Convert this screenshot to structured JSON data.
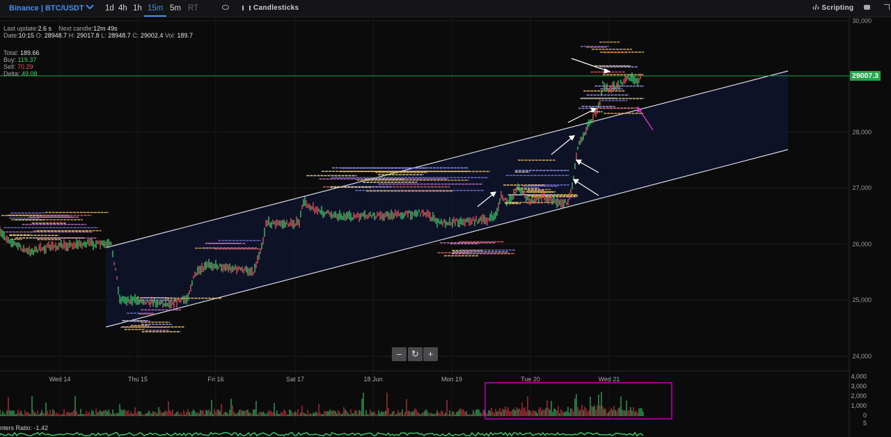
{
  "toolbar": {
    "symbol": "Binance | BTC/USDT",
    "timeframes": [
      "1d",
      "4h",
      "1h",
      "15m",
      "5m",
      "RT"
    ],
    "active_timeframe": "15m",
    "chart_type": "Candlesticks",
    "scripting": "Scripting"
  },
  "info": {
    "last_update_label": "Last update:",
    "last_update": "2.6 s",
    "next_candle_label": "Next candle:",
    "next_candle": "12m 49s",
    "date_label": "Date:",
    "date": "10:15",
    "open_label": "O:",
    "open": "28948.7",
    "high_label": "H:",
    "high": "29017.8",
    "low_label": "L:",
    "low": "28948.7",
    "close_label": "C:",
    "close": "29002.4",
    "vol_label": "Vol:",
    "vol": "189.7",
    "total_label": "Total:",
    "total": "189.66",
    "buy_label": "Buy:",
    "buy": "119.37",
    "sell_label": "Sell:",
    "sell": "70.29",
    "delta_label": "Delta:",
    "delta": "49.08"
  },
  "price_axis": [
    "30,000",
    "29,000",
    "28,000",
    "27,000",
    "26,000",
    "25,000",
    "24,000"
  ],
  "current_price": "29007.3",
  "date_axis": [
    "Wed 14",
    "Thu 15",
    "Fri 16",
    "Sat 17",
    "18 Jun",
    "Mon 19",
    "Tue 20",
    "Wed 21"
  ],
  "volume_axis": [
    "4,000",
    "3,000",
    "2,000",
    "1,000",
    "0",
    "5"
  ],
  "zoom": {
    "minus": "–",
    "reset": "↻",
    "plus": "+"
  },
  "footer_ratio_label": "nters Ratio:",
  "footer_ratio": "-1.42",
  "colors": {
    "accent": "#3f8ef0",
    "up": "#3fcf6d",
    "down": "#e8555e",
    "channel": "#d9dbe6",
    "annotation": "#c000c0"
  }
}
